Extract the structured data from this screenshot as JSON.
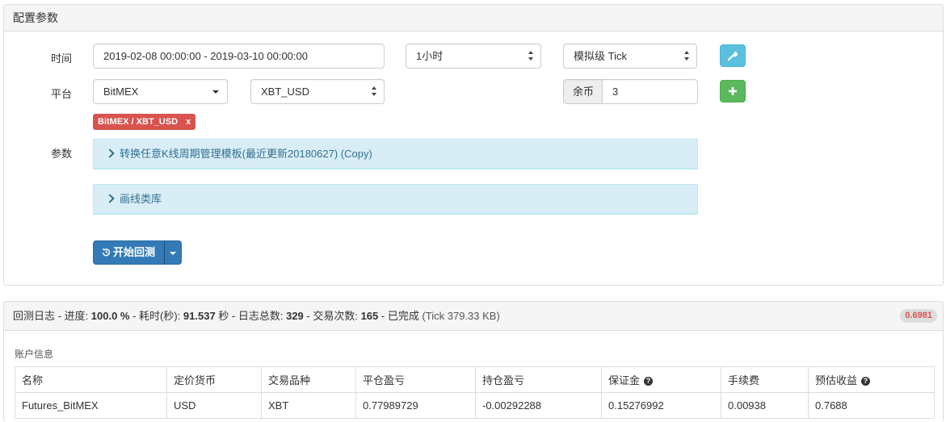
{
  "config": {
    "title": "配置参数",
    "time_label": "时间",
    "date_range": "2019-02-08 00:00:00 - 2019-03-10 00:00:00",
    "period": "1小时",
    "mode": "模拟级 Tick",
    "platform_label": "平台",
    "exchange": "BitMEX",
    "symbol": "XBT_USD",
    "balance_label": "余币",
    "balance_value": "3",
    "pair_tag": "BitMEX / XBT_USD",
    "pair_tag_close": "x",
    "params_label": "参数",
    "param_groups": [
      "转换任意K线周期管理模板(最近更新20180627) (Copy)",
      "画线类库"
    ],
    "run_label": "开始回测"
  },
  "log": {
    "prefix": "回测日志 - 进度: ",
    "progress": "100.0 %",
    "elapsed_label": " - 耗时(秒): ",
    "elapsed": "91.537",
    "elapsed_unit": " 秒",
    "log_count_label": " - 日志总数: ",
    "log_count": "329",
    "trade_count_label": " - 交易次数: ",
    "trade_count": "165",
    "status": " - 已完成 ",
    "tick_info": "(Tick 379.33 KB)",
    "badge": "0.6981"
  },
  "account": {
    "title": "账户信息",
    "columns": [
      "名称",
      "定价货币",
      "交易品种",
      "平仓盈亏",
      "持仓盈亏",
      "保证金",
      "手续费",
      "预估收益"
    ],
    "rows": [
      [
        "Futures_BitMEX",
        "USD",
        "XBT",
        "0.77989729",
        "-0.00292288",
        "0.15276992",
        "0.00938",
        "0.7688"
      ]
    ]
  },
  "colors": {
    "primary": "#337ab7",
    "info": "#5bc0de",
    "success": "#5cb85c",
    "danger": "#d9534f",
    "collapse_bg": "#d9edf7"
  },
  "icons": {
    "settings": "wrench-icon",
    "add": "plus-icon",
    "run": "history-icon",
    "help": "question-circle-icon"
  }
}
